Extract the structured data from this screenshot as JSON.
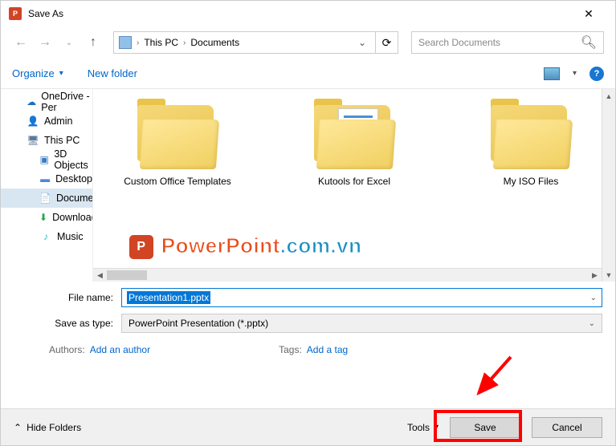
{
  "titlebar": {
    "title": "Save As"
  },
  "nav": {
    "breadcrumb": [
      "This PC",
      "Documents"
    ],
    "search_placeholder": "Search Documents"
  },
  "toolbar": {
    "organize": "Organize",
    "new_folder": "New folder"
  },
  "tree": {
    "items": [
      {
        "label": "OneDrive - Per",
        "icon": "cloud"
      },
      {
        "label": "Admin",
        "icon": "user"
      },
      {
        "label": "This PC",
        "icon": "computer"
      },
      {
        "label": "3D Objects",
        "icon": "3d",
        "indent": true
      },
      {
        "label": "Desktop",
        "icon": "desktop",
        "indent": true
      },
      {
        "label": "Documents",
        "icon": "documents",
        "indent": true,
        "selected": true
      },
      {
        "label": "Downloads",
        "icon": "download",
        "indent": true
      },
      {
        "label": "Music",
        "icon": "music",
        "indent": true
      }
    ]
  },
  "folders": {
    "items": [
      {
        "label": "Custom Office Templates",
        "has_papers": false
      },
      {
        "label": "Kutools for Excel",
        "has_papers": true
      },
      {
        "label": "My ISO Files",
        "has_papers": false
      }
    ]
  },
  "form": {
    "filename_label": "File name:",
    "filename_value": "Presentation1.pptx",
    "savetype_label": "Save as type:",
    "savetype_value": "PowerPoint Presentation (*.pptx)",
    "authors_label": "Authors:",
    "authors_link": "Add an author",
    "tags_label": "Tags:",
    "tags_link": "Add a tag"
  },
  "footer": {
    "hide_folders": "Hide Folders",
    "tools": "Tools",
    "save": "Save",
    "cancel": "Cancel"
  },
  "watermark": {
    "part1": "PowerPoint",
    "part2": ".com.vn"
  }
}
